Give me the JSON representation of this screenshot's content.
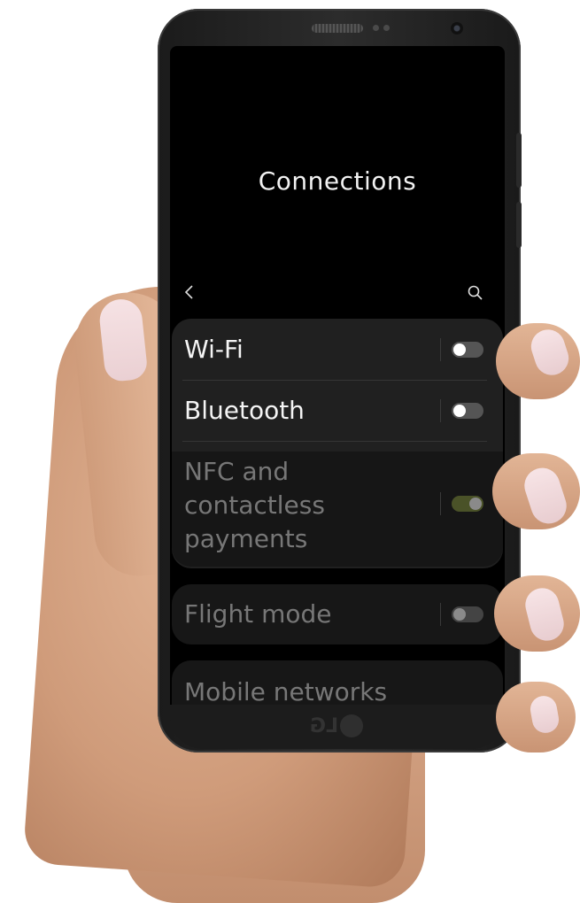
{
  "screen": {
    "title": "Connections",
    "back_icon": "chevron-left-icon",
    "search_icon": "search-icon"
  },
  "settings": [
    {
      "label": "Wi-Fi",
      "state": "off"
    },
    {
      "label": "Bluetooth",
      "state": "off"
    },
    {
      "label": "NFC and contactless payments",
      "state": "on"
    },
    {
      "label": "Flight mode",
      "state": "off"
    },
    {
      "label": "Mobile networks"
    }
  ],
  "device": {
    "brand_logo": "LG"
  },
  "colors": {
    "screen_bg": "#000000",
    "group_bg": "#202020",
    "toggle_on": "#5d6a34",
    "text_primary": "#f4f4f4",
    "text_dim": "#777777"
  }
}
